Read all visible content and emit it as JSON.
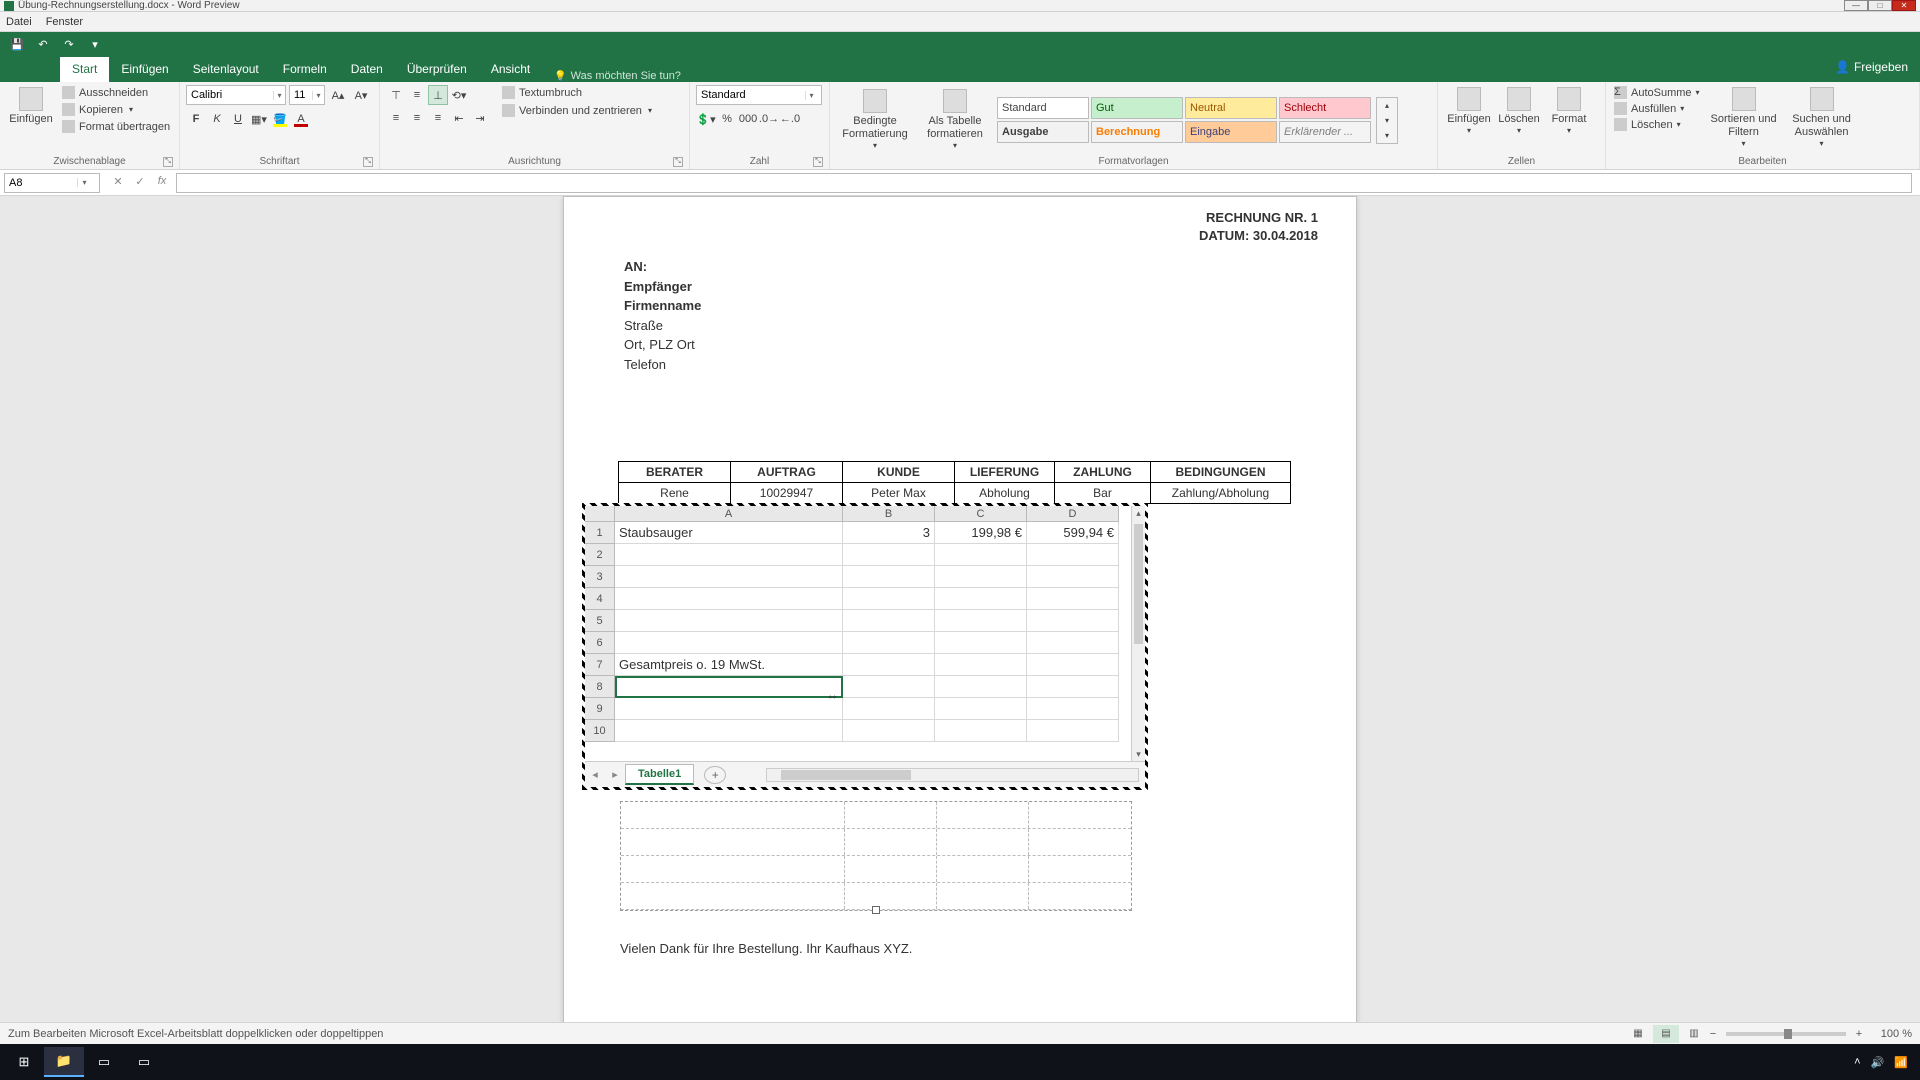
{
  "window": {
    "title": "Übung-Rechnungserstellung.docx - Word Preview"
  },
  "menubar": {
    "file": "Datei",
    "window": "Fenster"
  },
  "ribbon": {
    "tabs": {
      "start": "Start",
      "einfuegen": "Einfügen",
      "seitenlayout": "Seitenlayout",
      "formeln": "Formeln",
      "daten": "Daten",
      "ueberpruefen": "Überprüfen",
      "ansicht": "Ansicht"
    },
    "tellme": "Was möchten Sie tun?",
    "share": "Freigeben",
    "clipboard": {
      "paste": "Einfügen",
      "cut": "Ausschneiden",
      "copy": "Kopieren",
      "formatpainter": "Format übertragen",
      "group": "Zwischenablage"
    },
    "font": {
      "name": "Calibri",
      "size": "11",
      "bold": "F",
      "italic": "K",
      "underline": "U",
      "group": "Schriftart"
    },
    "align": {
      "wrap": "Textumbruch",
      "merge": "Verbinden und zentrieren",
      "group": "Ausrichtung"
    },
    "number": {
      "format": "Standard",
      "group": "Zahl"
    },
    "styles": {
      "cond": "Bedingte Formatierung",
      "astable": "Als Tabelle formatieren",
      "s1": "Standard",
      "s2": "Gut",
      "s3": "Neutral",
      "s4": "Schlecht",
      "s5": "Ausgabe",
      "s6": "Berechnung",
      "s7": "Eingabe",
      "s8": "Erklärender ...",
      "group": "Formatvorlagen"
    },
    "cells": {
      "insert": "Einfügen",
      "delete": "Löschen",
      "format": "Format",
      "group": "Zellen"
    },
    "editing": {
      "autosum": "AutoSumme",
      "fill": "Ausfüllen",
      "clear": "Löschen",
      "sort": "Sortieren und Filtern",
      "find": "Suchen und Auswählen",
      "group": "Bearbeiten"
    }
  },
  "namebox": "A8",
  "doc": {
    "invoice_no_label": "RECHNUNG NR. 1",
    "date_label": "DATUM: 30.04.2018",
    "to": "AN:",
    "recipient": "Empfänger",
    "company": "Firmenname",
    "street": "Straße",
    "city": "Ort, PLZ Ort",
    "phone": "Telefon",
    "th": {
      "berater": "BERATER",
      "auftrag": "AUFTRAG",
      "kunde": "KUNDE",
      "lieferung": "LIEFERUNG",
      "zahlung": "ZAHLUNG",
      "bedingungen": "BEDINGUNGEN"
    },
    "tr": {
      "berater": "Rene",
      "auftrag": "10029947",
      "kunde": "Peter Max",
      "lieferung": "Abholung",
      "zahlung": "Bar",
      "bedingungen": "Zahlung/Abholung"
    },
    "thanks": "Vielen Dank für Ihre Bestellung. Ihr Kaufhaus XYZ."
  },
  "ole": {
    "cols": {
      "A": "A",
      "B": "B",
      "C": "C",
      "D": "D"
    },
    "rows": [
      "1",
      "2",
      "3",
      "4",
      "5",
      "6",
      "7",
      "8",
      "9",
      "10"
    ],
    "r1": {
      "a": "Staubsauger",
      "b": "3",
      "c": "199,98 €",
      "d": "599,94 €"
    },
    "r7": {
      "a": "Gesamtpreis o. 19 MwSt."
    },
    "sheettab": "Tabelle1"
  },
  "status": {
    "msg": "Zum Bearbeiten Microsoft Excel-Arbeitsblatt doppelklicken oder doppeltippen",
    "zoom": "100 %"
  }
}
